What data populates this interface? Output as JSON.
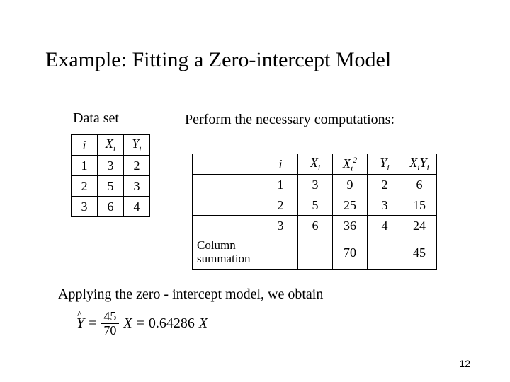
{
  "title": "Example:  Fitting a Zero-intercept Model",
  "dataSetLabel": "Data set",
  "performLabel": "Perform the necessary computations:",
  "dataHeaders": {
    "i": "i",
    "X": "X",
    "Xsub": "i",
    "Y": "Y",
    "Ysub": "i"
  },
  "dataRows": [
    {
      "i": "1",
      "X": "3",
      "Y": "2"
    },
    {
      "i": "2",
      "X": "5",
      "Y": "3"
    },
    {
      "i": "3",
      "X": "6",
      "Y": "4"
    }
  ],
  "compHeaders": {
    "blank": "",
    "i": "i",
    "X": "X",
    "Xsub": "i",
    "X2": "X",
    "X2sub": "i",
    "X2sup": "2",
    "Y": "Y",
    "Ysub": "i",
    "XY": "X",
    "XYsub": "i",
    "XY2": "Y",
    "XY2sub": "i"
  },
  "compRows": [
    {
      "i": "1",
      "X": "3",
      "X2": "9",
      "Y": "2",
      "XY": "6"
    },
    {
      "i": "2",
      "X": "5",
      "X2": "25",
      "Y": "3",
      "XY": "15"
    },
    {
      "i": "3",
      "X": "6",
      "X2": "36",
      "Y": "4",
      "XY": "24"
    }
  ],
  "sumLabel1": "Column",
  "sumLabel2": "summation",
  "sumX2": "70",
  "sumXY": "45",
  "applyingLine": "Applying  the  zero - intercept  model,  we  obtain",
  "equation": {
    "Yhat": "Y",
    "eq1": "=",
    "num": "45",
    "den": "70",
    "Xvar": "X",
    "eq2": "=",
    "coef": "0.64286",
    "Xvar2": "X"
  },
  "pageNumber": "12",
  "chart_data": {
    "type": "table",
    "title": "Zero-intercept regression computations",
    "data_set": {
      "i": [
        1,
        2,
        3
      ],
      "X": [
        3,
        5,
        6
      ],
      "Y": [
        2,
        3,
        4
      ]
    },
    "computations": {
      "i": [
        1,
        2,
        3
      ],
      "X": [
        3,
        5,
        6
      ],
      "X_squared": [
        9,
        25,
        36
      ],
      "Y": [
        2,
        3,
        4
      ],
      "XY": [
        6,
        15,
        24
      ],
      "sum_X_squared": 70,
      "sum_XY": 45
    },
    "model": {
      "formula": "Yhat = (sum_XY / sum_X_squared) * X",
      "slope": 0.64286
    }
  }
}
